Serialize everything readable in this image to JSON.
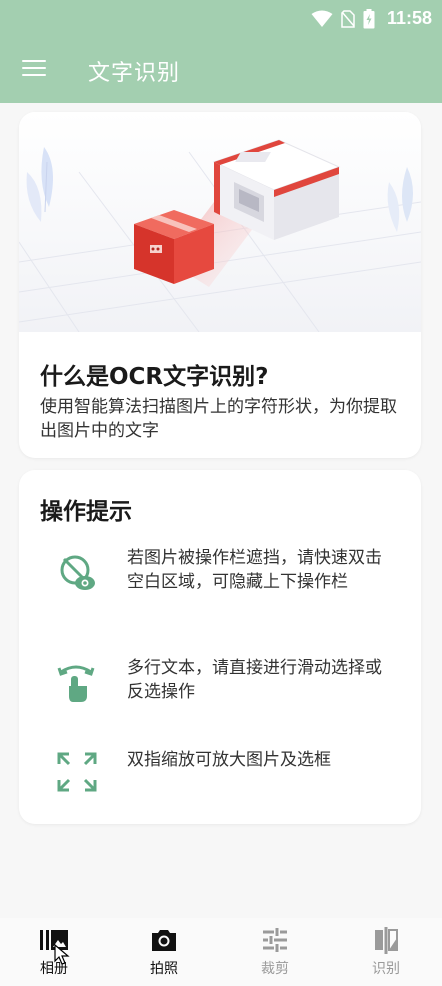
{
  "status_bar": {
    "time": "11:58",
    "icons": [
      "wifi-icon",
      "no-sim-icon",
      "battery-charging-icon"
    ]
  },
  "app_bar": {
    "title": "文字识别",
    "menu_icon": "hamburger-menu-icon"
  },
  "intro_card": {
    "title": "什么是OCR文字识别?",
    "description": "使用智能算法扫描图片上的字符形状，为你提取出图片中的文字"
  },
  "tips_card": {
    "title": "操作提示",
    "tips": [
      {
        "icon": "eye-hide-icon",
        "text": "若图片被操作栏遮挡，请快速双击空白区域，可隐藏上下操作栏"
      },
      {
        "icon": "swipe-gesture-icon",
        "text": "多行文本，请直接进行滑动选择或反选操作"
      },
      {
        "icon": "expand-arrows-icon",
        "text": "双指缩放可放大图片及选框"
      }
    ]
  },
  "bottom_nav": {
    "items": [
      {
        "label": "相册",
        "icon": "gallery-icon",
        "state": "enabled"
      },
      {
        "label": "拍照",
        "icon": "camera-icon",
        "state": "enabled"
      },
      {
        "label": "裁剪",
        "icon": "sliders-icon",
        "state": "disabled"
      },
      {
        "label": "识别",
        "icon": "compare-icon",
        "state": "disabled"
      }
    ]
  },
  "colors": {
    "app_bar": "#a3cfb0",
    "accent": "#5fa883",
    "disabled": "#9a9a9a"
  }
}
